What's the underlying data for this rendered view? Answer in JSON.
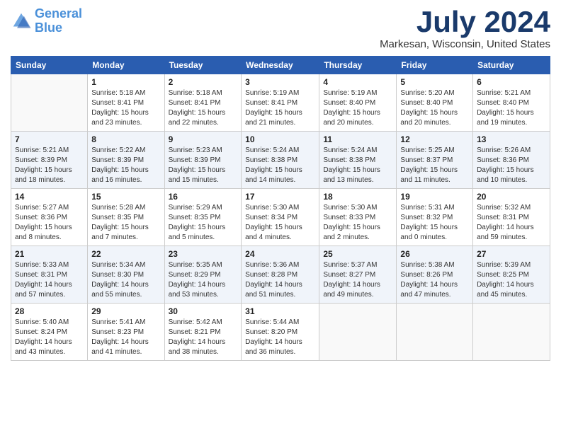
{
  "header": {
    "logo_line1": "General",
    "logo_line2": "Blue",
    "month": "July 2024",
    "location": "Markesan, Wisconsin, United States"
  },
  "days_of_week": [
    "Sunday",
    "Monday",
    "Tuesday",
    "Wednesday",
    "Thursday",
    "Friday",
    "Saturday"
  ],
  "weeks": [
    [
      {
        "day": "",
        "info": ""
      },
      {
        "day": "1",
        "info": "Sunrise: 5:18 AM\nSunset: 8:41 PM\nDaylight: 15 hours\nand 23 minutes."
      },
      {
        "day": "2",
        "info": "Sunrise: 5:18 AM\nSunset: 8:41 PM\nDaylight: 15 hours\nand 22 minutes."
      },
      {
        "day": "3",
        "info": "Sunrise: 5:19 AM\nSunset: 8:41 PM\nDaylight: 15 hours\nand 21 minutes."
      },
      {
        "day": "4",
        "info": "Sunrise: 5:19 AM\nSunset: 8:40 PM\nDaylight: 15 hours\nand 20 minutes."
      },
      {
        "day": "5",
        "info": "Sunrise: 5:20 AM\nSunset: 8:40 PM\nDaylight: 15 hours\nand 20 minutes."
      },
      {
        "day": "6",
        "info": "Sunrise: 5:21 AM\nSunset: 8:40 PM\nDaylight: 15 hours\nand 19 minutes."
      }
    ],
    [
      {
        "day": "7",
        "info": "Sunrise: 5:21 AM\nSunset: 8:39 PM\nDaylight: 15 hours\nand 18 minutes."
      },
      {
        "day": "8",
        "info": "Sunrise: 5:22 AM\nSunset: 8:39 PM\nDaylight: 15 hours\nand 16 minutes."
      },
      {
        "day": "9",
        "info": "Sunrise: 5:23 AM\nSunset: 8:39 PM\nDaylight: 15 hours\nand 15 minutes."
      },
      {
        "day": "10",
        "info": "Sunrise: 5:24 AM\nSunset: 8:38 PM\nDaylight: 15 hours\nand 14 minutes."
      },
      {
        "day": "11",
        "info": "Sunrise: 5:24 AM\nSunset: 8:38 PM\nDaylight: 15 hours\nand 13 minutes."
      },
      {
        "day": "12",
        "info": "Sunrise: 5:25 AM\nSunset: 8:37 PM\nDaylight: 15 hours\nand 11 minutes."
      },
      {
        "day": "13",
        "info": "Sunrise: 5:26 AM\nSunset: 8:36 PM\nDaylight: 15 hours\nand 10 minutes."
      }
    ],
    [
      {
        "day": "14",
        "info": "Sunrise: 5:27 AM\nSunset: 8:36 PM\nDaylight: 15 hours\nand 8 minutes."
      },
      {
        "day": "15",
        "info": "Sunrise: 5:28 AM\nSunset: 8:35 PM\nDaylight: 15 hours\nand 7 minutes."
      },
      {
        "day": "16",
        "info": "Sunrise: 5:29 AM\nSunset: 8:35 PM\nDaylight: 15 hours\nand 5 minutes."
      },
      {
        "day": "17",
        "info": "Sunrise: 5:30 AM\nSunset: 8:34 PM\nDaylight: 15 hours\nand 4 minutes."
      },
      {
        "day": "18",
        "info": "Sunrise: 5:30 AM\nSunset: 8:33 PM\nDaylight: 15 hours\nand 2 minutes."
      },
      {
        "day": "19",
        "info": "Sunrise: 5:31 AM\nSunset: 8:32 PM\nDaylight: 15 hours\nand 0 minutes."
      },
      {
        "day": "20",
        "info": "Sunrise: 5:32 AM\nSunset: 8:31 PM\nDaylight: 14 hours\nand 59 minutes."
      }
    ],
    [
      {
        "day": "21",
        "info": "Sunrise: 5:33 AM\nSunset: 8:31 PM\nDaylight: 14 hours\nand 57 minutes."
      },
      {
        "day": "22",
        "info": "Sunrise: 5:34 AM\nSunset: 8:30 PM\nDaylight: 14 hours\nand 55 minutes."
      },
      {
        "day": "23",
        "info": "Sunrise: 5:35 AM\nSunset: 8:29 PM\nDaylight: 14 hours\nand 53 minutes."
      },
      {
        "day": "24",
        "info": "Sunrise: 5:36 AM\nSunset: 8:28 PM\nDaylight: 14 hours\nand 51 minutes."
      },
      {
        "day": "25",
        "info": "Sunrise: 5:37 AM\nSunset: 8:27 PM\nDaylight: 14 hours\nand 49 minutes."
      },
      {
        "day": "26",
        "info": "Sunrise: 5:38 AM\nSunset: 8:26 PM\nDaylight: 14 hours\nand 47 minutes."
      },
      {
        "day": "27",
        "info": "Sunrise: 5:39 AM\nSunset: 8:25 PM\nDaylight: 14 hours\nand 45 minutes."
      }
    ],
    [
      {
        "day": "28",
        "info": "Sunrise: 5:40 AM\nSunset: 8:24 PM\nDaylight: 14 hours\nand 43 minutes."
      },
      {
        "day": "29",
        "info": "Sunrise: 5:41 AM\nSunset: 8:23 PM\nDaylight: 14 hours\nand 41 minutes."
      },
      {
        "day": "30",
        "info": "Sunrise: 5:42 AM\nSunset: 8:21 PM\nDaylight: 14 hours\nand 38 minutes."
      },
      {
        "day": "31",
        "info": "Sunrise: 5:44 AM\nSunset: 8:20 PM\nDaylight: 14 hours\nand 36 minutes."
      },
      {
        "day": "",
        "info": ""
      },
      {
        "day": "",
        "info": ""
      },
      {
        "day": "",
        "info": ""
      }
    ]
  ]
}
